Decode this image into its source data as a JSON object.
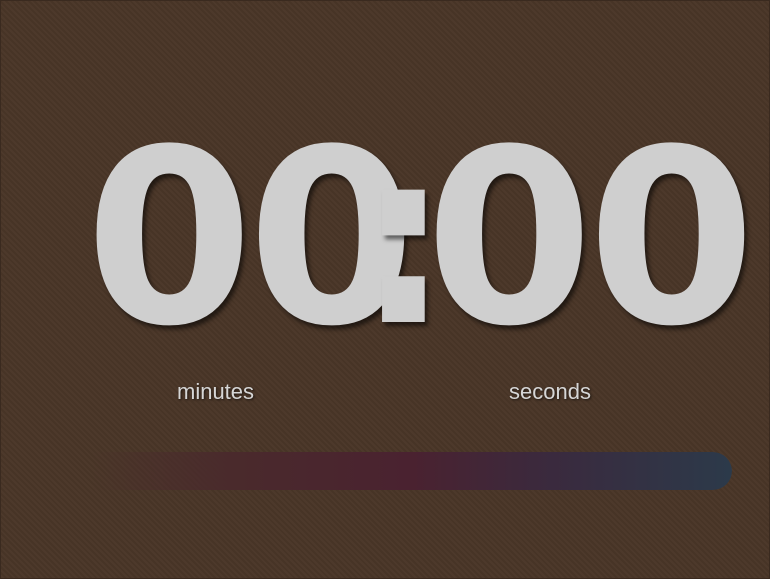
{
  "timer": {
    "minutes": "00",
    "separator": ":",
    "seconds": "00",
    "minutes_label": "minutes",
    "seconds_label": "seconds"
  },
  "progress": {
    "fraction": 1.0,
    "start_color": "#4a2a2c",
    "mid_color": "#4a2230",
    "end_color": "#2c3a4a"
  },
  "colors": {
    "background": "#4a3628",
    "digits": "#cfcfcf",
    "labels": "#d6d6d6"
  }
}
